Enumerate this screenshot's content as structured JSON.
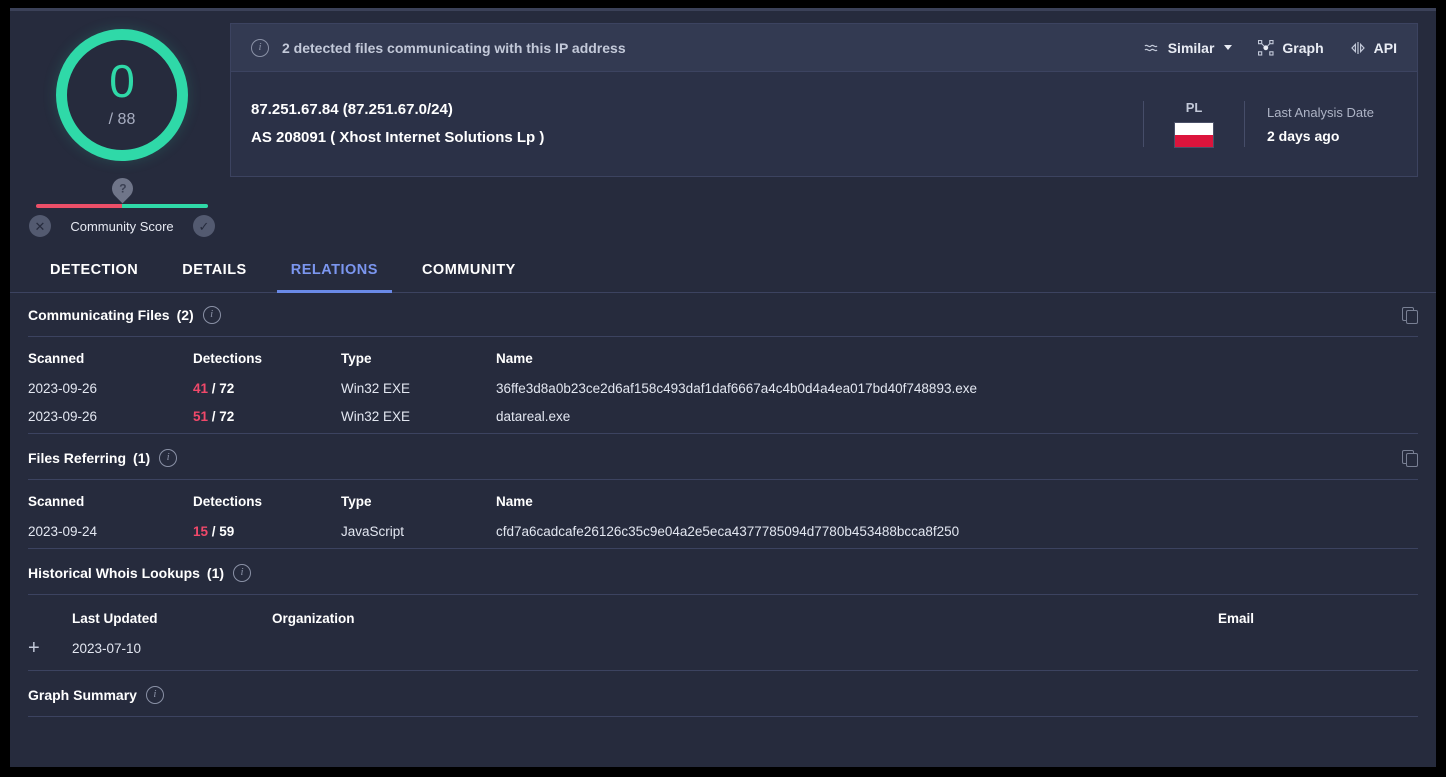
{
  "score": {
    "value": "0",
    "total": "/ 88",
    "ring_color": "#2fd9a8"
  },
  "community": {
    "label": "Community Score",
    "negative_icon": "✕",
    "positive_icon": "✓",
    "marker_icon": "?",
    "bar_negative_color": "#ec4f68",
    "bar_positive_color": "#2fd9a8"
  },
  "notice": {
    "text": "2 detected files communicating with this IP address",
    "info_icon": "i"
  },
  "actions": {
    "similar": "Similar",
    "graph": "Graph",
    "api": "API"
  },
  "ip": {
    "address_line": "87.251.67.84  (87.251.67.0/24)",
    "asn_line": "AS 208091  ( Xhost Internet Solutions Lp )"
  },
  "meta": {
    "country_code": "PL",
    "analysis_label": "Last Analysis Date",
    "analysis_value": "2 days ago"
  },
  "tabs": [
    {
      "label": "DETECTION",
      "active": false
    },
    {
      "label": "DETAILS",
      "active": false
    },
    {
      "label": "RELATIONS",
      "active": true
    },
    {
      "label": "COMMUNITY",
      "active": false
    }
  ],
  "communicating_files": {
    "title": "Communicating Files",
    "count": "(2)",
    "columns": [
      "Scanned",
      "Detections",
      "Type",
      "Name"
    ],
    "rows": [
      {
        "scanned": "2023-09-26",
        "detections_hit": "41",
        "detections_total": "/ 72",
        "type": "Win32 EXE",
        "name": "36ffe3d8a0b23ce2d6af158c493daf1daf6667a4c4b0d4a4ea017bd40f748893.exe"
      },
      {
        "scanned": "2023-09-26",
        "detections_hit": "51",
        "detections_total": "/ 72",
        "type": "Win32 EXE",
        "name": "datareal.exe"
      }
    ]
  },
  "files_referring": {
    "title": "Files Referring",
    "count": "(1)",
    "columns": [
      "Scanned",
      "Detections",
      "Type",
      "Name"
    ],
    "rows": [
      {
        "scanned": "2023-09-24",
        "detections_hit": "15",
        "detections_total": "/ 59",
        "type": "JavaScript",
        "name": "cfd7a6cadcafe26126c35c9e04a2e5eca4377785094d7780b453488bcca8f250"
      }
    ]
  },
  "historical_whois": {
    "title": "Historical Whois Lookups",
    "count": "(1)",
    "columns": [
      "Last Updated",
      "Organization",
      "Email"
    ],
    "rows": [
      {
        "expand": "+",
        "last_updated": "2023-07-10",
        "organization": "",
        "email": ""
      }
    ]
  },
  "graph_summary": {
    "title": "Graph Summary"
  }
}
